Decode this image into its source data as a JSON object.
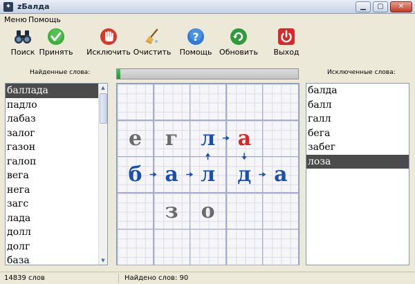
{
  "window": {
    "title": "zБалда"
  },
  "menu": {
    "items": [
      "Меню",
      "Помощь"
    ]
  },
  "toolbar": {
    "buttons": [
      {
        "label": "Поиск",
        "icon": "binoculars-icon"
      },
      {
        "label": "Принять",
        "icon": "check-icon"
      },
      {
        "label": "Исключить",
        "icon": "hand-stop-icon"
      },
      {
        "label": "Очистить",
        "icon": "broom-icon"
      },
      {
        "label": "Помощь",
        "icon": "help-icon"
      },
      {
        "label": "Обновить",
        "icon": "refresh-icon"
      },
      {
        "label": "Выход",
        "icon": "power-icon"
      }
    ]
  },
  "found_words": {
    "title": "Найденные слова:",
    "items": [
      "баллада",
      "падло",
      "лабаз",
      "залог",
      "газон",
      "галоп",
      "вега",
      "нега",
      "загс",
      "лада",
      "долл",
      "долг",
      "база"
    ],
    "selected_index": 0
  },
  "excluded_words": {
    "title": "Исключенные слова:",
    "items": [
      "балда",
      "балл",
      "галл",
      "бега",
      "забег",
      "лоза"
    ],
    "selected_index": 5
  },
  "progress": {
    "value": 0.02
  },
  "board": {
    "columns": 5,
    "rows": 5,
    "cells": [
      {
        "row": 1,
        "col": 0,
        "letter": "е",
        "color": "#6b6b6b"
      },
      {
        "row": 1,
        "col": 1,
        "letter": "г",
        "color": "#6b6b6b"
      },
      {
        "row": 1,
        "col": 2,
        "letter": "л",
        "color": "#1a4fb0"
      },
      {
        "row": 1,
        "col": 3,
        "letter": "а",
        "color": "#e32222"
      },
      {
        "row": 2,
        "col": 0,
        "letter": "б",
        "color": "#1a4fb0"
      },
      {
        "row": 2,
        "col": 1,
        "letter": "а",
        "color": "#1a4fb0"
      },
      {
        "row": 2,
        "col": 2,
        "letter": "л",
        "color": "#1a4fb0"
      },
      {
        "row": 2,
        "col": 3,
        "letter": "д",
        "color": "#1a4fb0"
      },
      {
        "row": 2,
        "col": 4,
        "letter": "а",
        "color": "#1a4fb0"
      },
      {
        "row": 3,
        "col": 1,
        "letter": "з",
        "color": "#6b6b6b"
      },
      {
        "row": 3,
        "col": 2,
        "letter": "о",
        "color": "#6b6b6b"
      }
    ],
    "path": [
      {
        "row": 2,
        "col": 0
      },
      {
        "row": 2,
        "col": 1
      },
      {
        "row": 2,
        "col": 2
      },
      {
        "row": 1,
        "col": 2
      },
      {
        "row": 1,
        "col": 3
      },
      {
        "row": 2,
        "col": 3
      },
      {
        "row": 2,
        "col": 4
      }
    ],
    "arrow_color": "#1a4fb0"
  },
  "status": {
    "dictionary_count": "14839 слов",
    "found_count": "Найдено слов: 90"
  }
}
